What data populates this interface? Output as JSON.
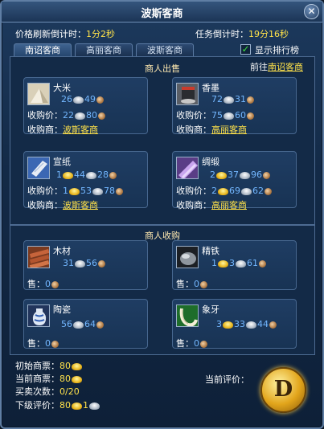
{
  "window": {
    "title": "波斯客商"
  },
  "top": {
    "refresh_label": "价格刷新倒计时：",
    "refresh_value": "1分2秒",
    "task_label": "任务倒计时：",
    "task_value": "19分16秒"
  },
  "tabs": [
    "南诏客商",
    "高丽客商",
    "波斯客商"
  ],
  "rank_toggle": {
    "label": "显示排行榜",
    "checked": true
  },
  "goto": {
    "prefix": "前往",
    "target": "南诏客商"
  },
  "sell_section": {
    "title": "商人出售"
  },
  "buy_section": {
    "title": "商人收购"
  },
  "labels": {
    "buy_price": "收购价：",
    "buy_merchant": "收购商：",
    "sell": "售："
  },
  "sell_items": [
    {
      "name": "大米",
      "icon": "rice-icon",
      "price": [
        "26",
        "49"
      ],
      "buy_price": [
        "22",
        "80"
      ],
      "merchant": "波斯客商"
    },
    {
      "name": "香墨",
      "icon": "ink-icon",
      "price": [
        "72",
        "31"
      ],
      "buy_price": [
        "75",
        "60"
      ],
      "merchant": "高丽客商"
    },
    {
      "name": "宣纸",
      "icon": "paper-scroll-icon",
      "price": [
        "1",
        "44",
        "28"
      ],
      "buy_price": [
        "1",
        "53",
        "78"
      ],
      "merchant": "波斯客商"
    },
    {
      "name": "绸缎",
      "icon": "silk-icon",
      "price": [
        "2",
        "37",
        "96"
      ],
      "buy_price": [
        "2",
        "69",
        "62"
      ],
      "merchant": "高丽客商"
    }
  ],
  "buy_items": [
    {
      "name": "木材",
      "icon": "wood-icon",
      "price": [
        "31",
        "56"
      ],
      "sell": "0"
    },
    {
      "name": "精铁",
      "icon": "iron-icon",
      "price": [
        "1",
        "3",
        "61"
      ],
      "sell": "0"
    },
    {
      "name": "陶瓷",
      "icon": "porcelain-icon",
      "price": [
        "56",
        "64"
      ],
      "sell": "0"
    },
    {
      "name": "象牙",
      "icon": "ivory-icon",
      "price": [
        "3",
        "33",
        "44"
      ],
      "sell": "0"
    }
  ],
  "stats": {
    "initial_label": "初始商票：",
    "initial_value": "80",
    "current_label": "当前商票：",
    "current_value": "80",
    "trades_label": "买卖次数：",
    "trades_value": "0/20",
    "next_label": "下级评价：",
    "next_gold": "80",
    "next_silver": "1"
  },
  "evaluation": {
    "label": "当前评价：",
    "grade": "D"
  }
}
